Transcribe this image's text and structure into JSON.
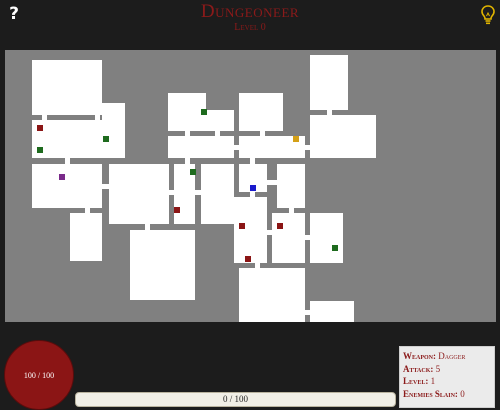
{
  "header": {
    "title": "Dungeoneer",
    "level_label": "Level 0",
    "help_label": "?"
  },
  "icons": {
    "help": "question-mark-icon",
    "bulb": "lightbulb-icon"
  },
  "colors": {
    "background": "#1c1c1c",
    "map_wall": "#808080",
    "floor": "#ffffff",
    "title_red": "#8b1a1a",
    "player": "#1a1acc",
    "enemy": "#8b1515",
    "health_item": "#1e6b1e",
    "weapon_item": "#7a2a8a",
    "stairs": "#d4a017",
    "bulb": "#e0b400"
  },
  "player": {
    "health_text": "100 / 100",
    "health": 100,
    "max_health": 100
  },
  "experience": {
    "text": "0 / 100",
    "fraction": 0
  },
  "stats": {
    "weapon_label": "Weapon:",
    "weapon_value": "Dagger",
    "attack_label": "Attack:",
    "attack_value": "5",
    "level_label": "Level:",
    "level_value": "1",
    "enemies_label": "Enemies Slain:",
    "enemies_value": "0"
  }
}
